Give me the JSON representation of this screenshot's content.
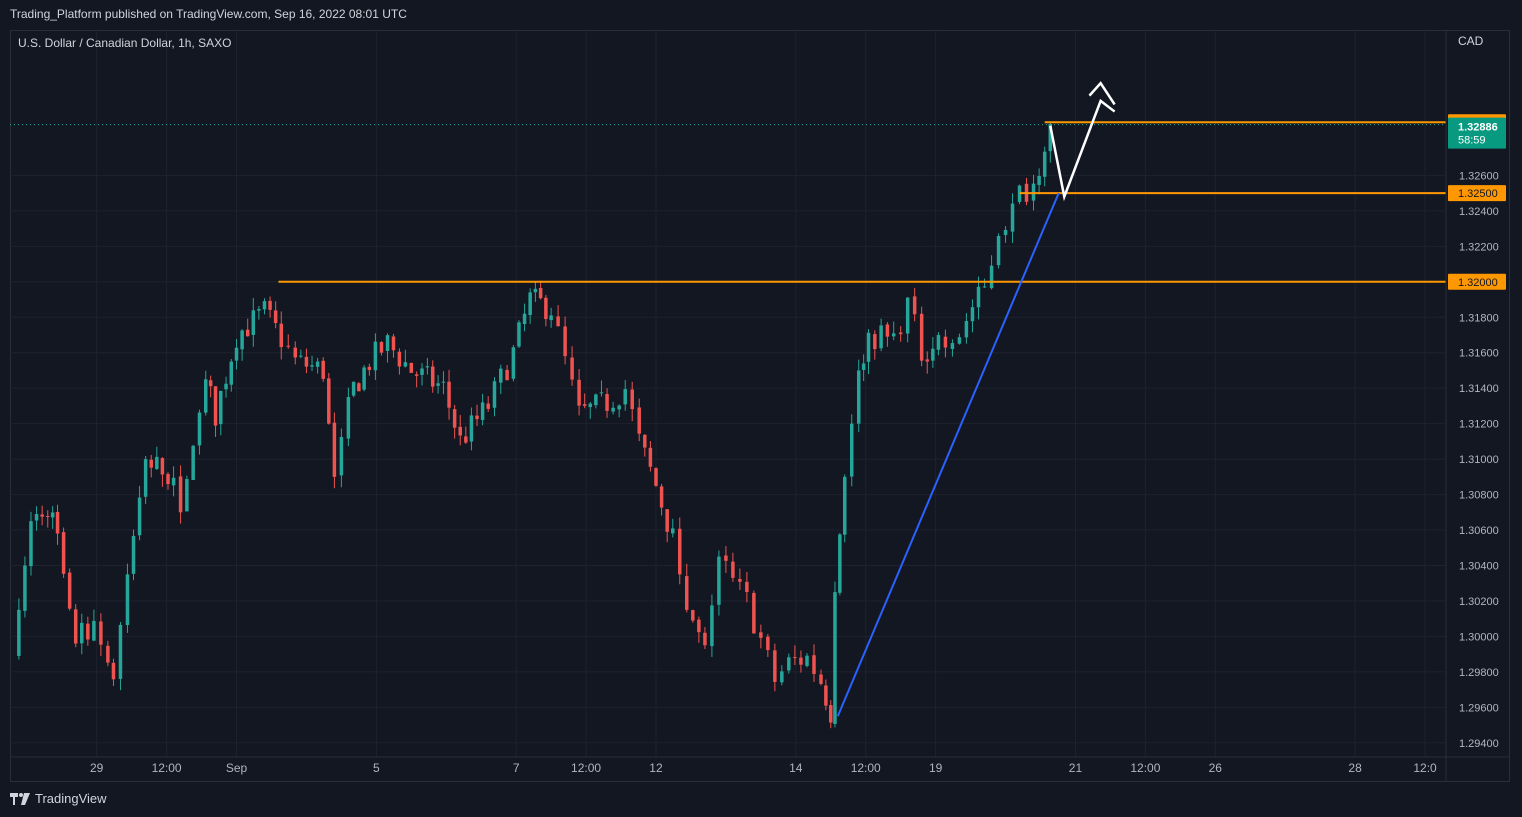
{
  "header": {
    "publish_line": "Trading_Platform published on TradingView.com, Sep 16, 2022 08:01 UTC"
  },
  "symbol_line": "U.S. Dollar / Canadian Dollar, 1h, SAXO",
  "footer": {
    "brand": "TradingView"
  },
  "colors": {
    "background": "#131722",
    "grid": "#1e222d",
    "up_candle": "#26a69a",
    "down_candle": "#ef5350",
    "level_line": "#ff9800",
    "trendline": "#2962ff",
    "projection_arrow": "#ffffff",
    "price_tag": "#089981"
  },
  "chart_data": {
    "type": "candlestick",
    "symbol": "U.S. Dollar / Canadian Dollar",
    "interval": "1h",
    "source": "SAXO",
    "currency": "CAD",
    "ylim": [
      1.2932,
      1.3342
    ],
    "y_ticks": [
      "1.32600",
      "1.32400",
      "1.32200",
      "1.32000",
      "1.31800",
      "1.31600",
      "1.31400",
      "1.31200",
      "1.31000",
      "1.30800",
      "1.30600",
      "1.30400",
      "1.30200",
      "1.30000",
      "1.29800",
      "1.29600",
      "1.29400"
    ],
    "x_ticks": [
      {
        "label": "29",
        "t": 0.6
      },
      {
        "label": "12:00",
        "t": 1.1
      },
      {
        "label": "Sep",
        "t": 1.6
      },
      {
        "label": "5",
        "t": 2.6
      },
      {
        "label": "7",
        "t": 3.6
      },
      {
        "label": "12:00",
        "t": 4.1
      },
      {
        "label": "12",
        "t": 4.6
      },
      {
        "label": "14",
        "t": 5.6
      },
      {
        "label": "12:00",
        "t": 6.1
      },
      {
        "label": "19",
        "t": 6.6
      },
      {
        "label": "21",
        "t": 7.6
      },
      {
        "label": "12:00",
        "t": 8.1
      },
      {
        "label": "26",
        "t": 8.6
      },
      {
        "label": "28",
        "t": 9.6
      },
      {
        "label": "12:0",
        "t": 10.1
      }
    ],
    "anchors": [
      [
        0.0,
        1.299
      ],
      [
        0.13,
        1.3065
      ],
      [
        0.25,
        1.3075
      ],
      [
        0.32,
        1.3055
      ],
      [
        0.45,
        1.2996
      ],
      [
        0.58,
        1.301
      ],
      [
        0.68,
        1.2985
      ],
      [
        0.72,
        1.2978
      ],
      [
        0.82,
        1.3035
      ],
      [
        0.95,
        1.31
      ],
      [
        1.15,
        1.3088
      ],
      [
        1.2,
        1.307
      ],
      [
        1.38,
        1.3145
      ],
      [
        1.45,
        1.3125
      ],
      [
        1.6,
        1.317
      ],
      [
        1.8,
        1.3183
      ],
      [
        1.92,
        1.3168
      ],
      [
        2.02,
        1.3155
      ],
      [
        2.22,
        1.315
      ],
      [
        2.3,
        1.309
      ],
      [
        2.4,
        1.3135
      ],
      [
        2.55,
        1.3155
      ],
      [
        2.68,
        1.3165
      ],
      [
        2.85,
        1.315
      ],
      [
        3.08,
        1.314
      ],
      [
        3.2,
        1.311
      ],
      [
        3.4,
        1.313
      ],
      [
        3.58,
        1.316
      ],
      [
        3.7,
        1.319
      ],
      [
        3.85,
        1.3185
      ],
      [
        3.95,
        1.3155
      ],
      [
        4.05,
        1.3125
      ],
      [
        4.25,
        1.3132
      ],
      [
        4.38,
        1.314
      ],
      [
        4.48,
        1.311
      ],
      [
        4.6,
        1.3085
      ],
      [
        4.72,
        1.3055
      ],
      [
        4.82,
        1.3015
      ],
      [
        4.95,
        1.299
      ],
      [
        5.05,
        1.3045
      ],
      [
        5.15,
        1.303
      ],
      [
        5.25,
        1.302
      ],
      [
        5.35,
        1.2998
      ],
      [
        5.45,
        1.2975
      ],
      [
        5.55,
        1.2985
      ],
      [
        5.68,
        1.2988
      ],
      [
        5.78,
        1.2975
      ],
      [
        5.85,
        1.2958
      ],
      [
        5.88,
        1.3025
      ],
      [
        5.95,
        1.309
      ],
      [
        6.05,
        1.315
      ],
      [
        6.12,
        1.317
      ],
      [
        6.3,
        1.3168
      ],
      [
        6.4,
        1.3188
      ],
      [
        6.5,
        1.316
      ],
      [
        6.62,
        1.3168
      ],
      [
        6.72,
        1.316
      ],
      [
        6.82,
        1.318
      ],
      [
        6.95,
        1.3195
      ],
      [
        7.05,
        1.323
      ],
      [
        7.15,
        1.324
      ],
      [
        7.2,
        1.325
      ],
      [
        7.3,
        1.3255
      ],
      [
        7.38,
        1.328
      ],
      [
        7.42,
        1.3289
      ]
    ],
    "x_domain": [
      -0.02,
      10.25
    ],
    "levels": [
      {
        "price": 1.329,
        "label": "1.32900",
        "t_start": 7.38
      },
      {
        "price": 1.325,
        "label": "1.32500",
        "t_start": 7.2
      },
      {
        "price": 1.32,
        "label": "1.32000",
        "t_start": 1.9
      }
    ],
    "last_price": {
      "price": 1.32886,
      "label": "1.32886",
      "countdown": "58:59"
    },
    "trendline": [
      [
        5.9,
        1.2955
      ],
      [
        7.48,
        1.325
      ]
    ],
    "projection_path": [
      [
        7.42,
        1.3288
      ],
      [
        7.52,
        1.3248
      ],
      [
        7.78,
        1.3302
      ],
      [
        7.88,
        1.3296
      ]
    ],
    "projection_arrowhead": [
      [
        7.7,
        1.3305
      ],
      [
        7.78,
        1.3312
      ],
      [
        7.88,
        1.33
      ]
    ]
  }
}
